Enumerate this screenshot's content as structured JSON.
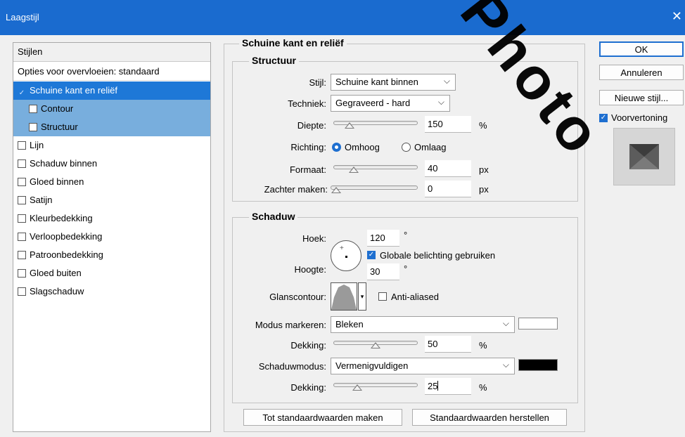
{
  "window": {
    "title": "Laagstijl"
  },
  "styles_panel": {
    "header": "Stijlen",
    "blending_options": "Opties voor overvloeien: standaard",
    "items": [
      {
        "label": "Schuine kant en reliëf",
        "checked": true
      },
      {
        "label": "Contour",
        "checked": false
      },
      {
        "label": "Structuur",
        "checked": false
      },
      {
        "label": "Lijn",
        "checked": false
      },
      {
        "label": "Schaduw binnen",
        "checked": false
      },
      {
        "label": "Gloed binnen",
        "checked": false
      },
      {
        "label": "Satijn",
        "checked": false
      },
      {
        "label": "Kleurbedekking",
        "checked": false
      },
      {
        "label": "Verloopbedekking",
        "checked": false
      },
      {
        "label": "Patroonbedekking",
        "checked": false
      },
      {
        "label": "Gloed buiten",
        "checked": false
      },
      {
        "label": "Slagschaduw",
        "checked": false
      }
    ]
  },
  "section": {
    "title": "Schuine kant en reliëf"
  },
  "structure": {
    "title": "Structuur",
    "style_label": "Stijl:",
    "style_value": "Schuine kant binnen",
    "technique_label": "Techniek:",
    "technique_value": "Gegraveerd - hard",
    "depth_label": "Diepte:",
    "depth_value": "150",
    "depth_unit": "%",
    "depth_slider": 0.14,
    "direction_label": "Richting:",
    "direction_up": "Omhoog",
    "direction_down": "Omlaag",
    "size_label": "Formaat:",
    "size_value": "40",
    "size_unit": "px",
    "size_slider": 0.2,
    "soften_label": "Zachter maken:",
    "soften_value": "0",
    "soften_unit": "px",
    "soften_slider": 0.0
  },
  "shading": {
    "title": "Schaduw",
    "angle_label": "Hoek:",
    "angle_value": "120",
    "angle_unit": "°",
    "global_light_label": "Globale belichting gebruiken",
    "global_light_checked": true,
    "altitude_label": "Hoogte:",
    "altitude_value": "30",
    "altitude_unit": "°",
    "gloss_label": "Glanscontour:",
    "anti_aliased_label": "Anti-aliased",
    "highlight_mode_label": "Modus markeren:",
    "highlight_mode_value": "Bleken",
    "highlight_color": "#ffffff",
    "highlight_opacity_label": "Dekking:",
    "highlight_opacity_value": "50",
    "highlight_opacity_unit": "%",
    "highlight_opacity_slider": 0.5,
    "shadow_mode_label": "Schaduwmodus:",
    "shadow_mode_value": "Vermenigvuldigen",
    "shadow_color": "#000000",
    "shadow_opacity_label": "Dekking:",
    "shadow_opacity_value": "25",
    "shadow_opacity_unit": "%",
    "shadow_opacity_slider": 0.25
  },
  "bottom_buttons": {
    "make_default": "Tot standaardwaarden maken",
    "reset_default": "Standaardwaarden herstellen"
  },
  "right_buttons": {
    "ok": "OK",
    "cancel": "Annuleren",
    "new_style": "Nieuwe stijl...",
    "preview_label": "Voorvertoning",
    "preview_checked": true
  },
  "watermark": {
    "text": "Photo"
  },
  "colors": {
    "title_bar": "#1a6bcf",
    "selection": "#1e78d7",
    "sub_selection": "#78aedd",
    "accent": "#1e6fd0"
  }
}
